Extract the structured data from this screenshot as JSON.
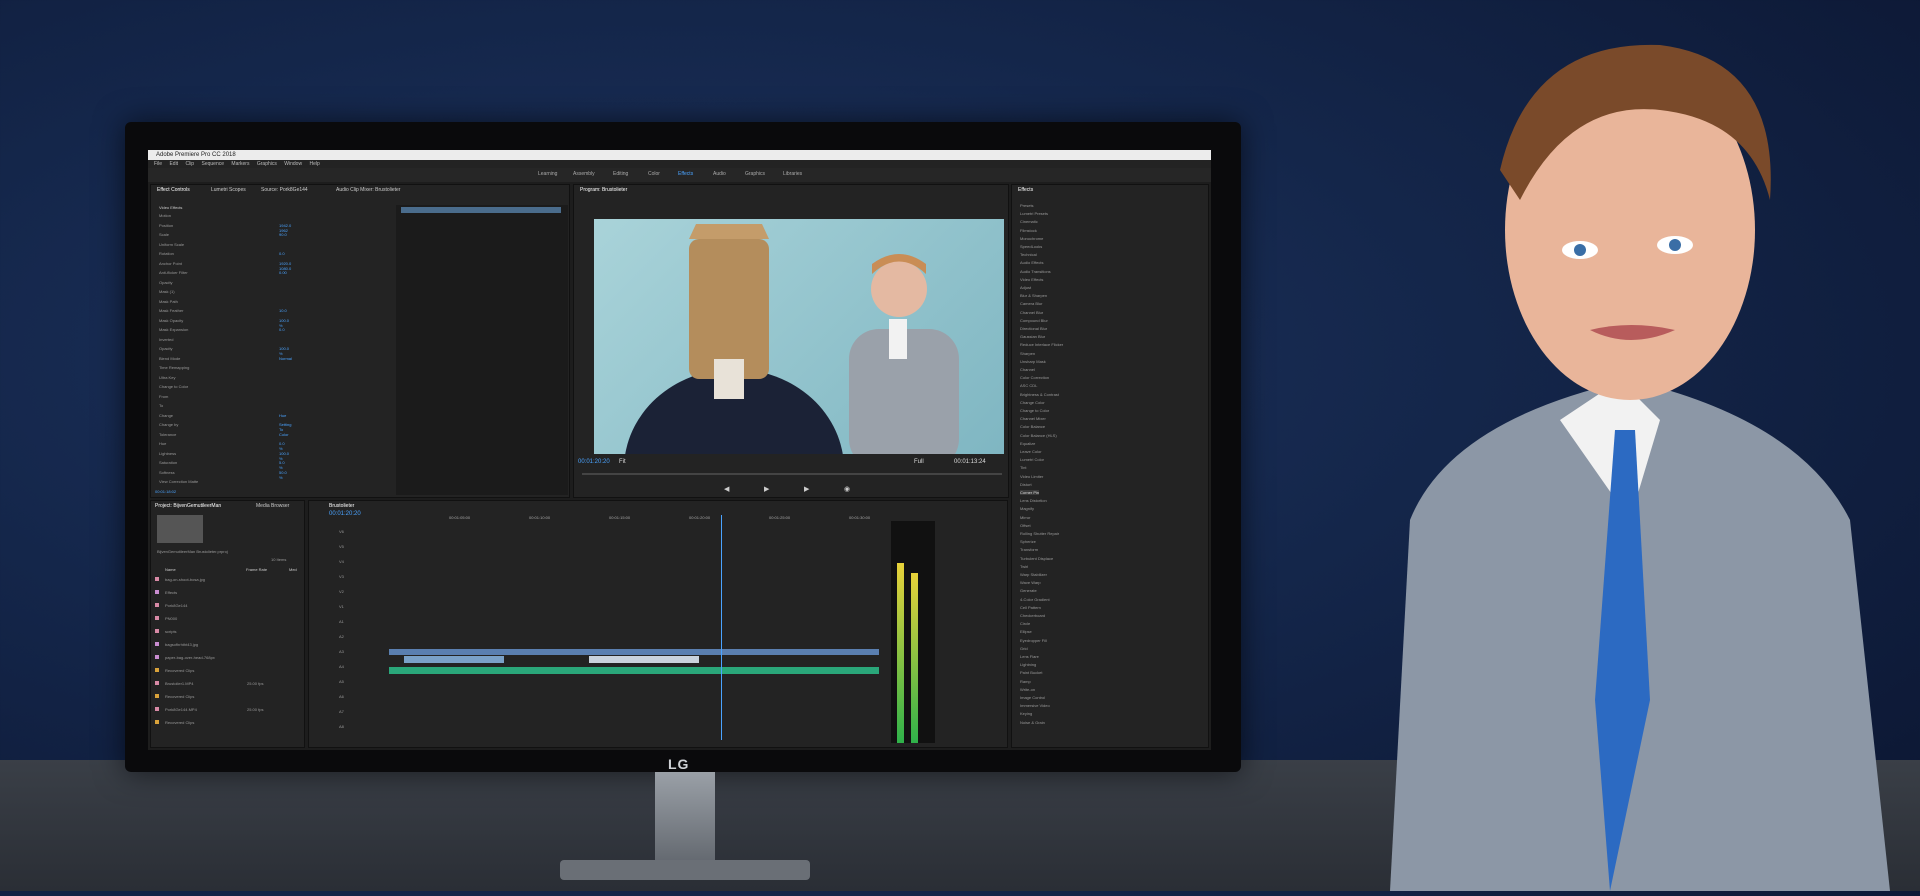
{
  "scene": {
    "monitor_brand": "LG"
  },
  "app": {
    "title": "Adobe Premiere Pro CC 2018",
    "menu": [
      "File",
      "Edit",
      "Clip",
      "Sequence",
      "Markers",
      "Graphics",
      "Window",
      "Help"
    ],
    "workspaces": [
      "Learning",
      "Assembly",
      "Editing",
      "Color",
      "Effects",
      "Audio",
      "Graphics",
      "Libraries"
    ],
    "active_workspace": "Effects"
  },
  "effect_controls": {
    "tabs": [
      "Effect Controls",
      "Lumetri Scopes",
      "Source: Pork8Ge144",
      "Audio Clip Mixer: Brustolieter"
    ],
    "section": "Video Effects",
    "rows": [
      {
        "name": "Motion",
        "value": ""
      },
      {
        "name": "Position",
        "value": "1942.0  1962"
      },
      {
        "name": "Scale",
        "value": "90.0"
      },
      {
        "name": "Uniform Scale",
        "value": ""
      },
      {
        "name": "Rotation",
        "value": "0.0"
      },
      {
        "name": "Anchor Point",
        "value": "1920.0  1080.0"
      },
      {
        "name": "Anti-flicker Filter",
        "value": "0.00"
      },
      {
        "name": "Opacity",
        "value": ""
      },
      {
        "name": "Mask (1)",
        "value": ""
      },
      {
        "name": "Mask Path",
        "value": ""
      },
      {
        "name": "Mask Feather",
        "value": "10.0"
      },
      {
        "name": "Mask Opacity",
        "value": "100.0 %"
      },
      {
        "name": "Mask Expansion",
        "value": "0.0"
      },
      {
        "name": "Inverted",
        "value": ""
      },
      {
        "name": "Opacity",
        "value": "100.0 %"
      },
      {
        "name": "Blend Mode",
        "value": "Normal"
      },
      {
        "name": "Time Remapping",
        "value": ""
      },
      {
        "name": "Ultra Key",
        "value": ""
      },
      {
        "name": "Change to Color",
        "value": ""
      },
      {
        "name": "From",
        "value": ""
      },
      {
        "name": "To",
        "value": ""
      },
      {
        "name": "Change",
        "value": "Hue"
      },
      {
        "name": "Change by",
        "value": "Setting To Color"
      },
      {
        "name": "Tolerance",
        "value": ""
      },
      {
        "name": "Hue",
        "value": "0.0 %"
      },
      {
        "name": "Lightness",
        "value": "100.0 %"
      },
      {
        "name": "Saturation",
        "value": "5.0 %"
      },
      {
        "name": "Softness",
        "value": "50.0 %"
      },
      {
        "name": "View Correction Matte",
        "value": ""
      }
    ],
    "timecode": "00:01:18:02"
  },
  "program_monitor": {
    "title": "Program: Brustolieter",
    "timecode": "00:01:20:20",
    "fit": "Fit",
    "quality": "Full",
    "duration": "00:01:13:24"
  },
  "project": {
    "tabs": [
      "Project: BijvenGemutileerMan",
      "Media Browser"
    ],
    "path": "BijvenGemutileerMan Brustolieter.prproj",
    "item_count": "10 Items",
    "columns": [
      "Name",
      "Frame Rate",
      "Med"
    ],
    "items": [
      {
        "name": "bag-on-shoot-bosa.jpg",
        "rate": ""
      },
      {
        "name": "Effects",
        "rate": ""
      },
      {
        "name": "Pork8Ge144",
        "rate": ""
      },
      {
        "name": "PN000",
        "rate": ""
      },
      {
        "name": "scripts",
        "rate": ""
      },
      {
        "name": "bagsofhrhtht43.jpg",
        "rate": ""
      },
      {
        "name": "paper-bag-over-head-768px",
        "rate": ""
      },
      {
        "name": "Recovered Clips",
        "rate": ""
      },
      {
        "name": "Brustolier1.MP4",
        "rate": "25.00 fps"
      },
      {
        "name": "Recovered Clips",
        "rate": ""
      },
      {
        "name": "Pork8Ge144.MP4",
        "rate": "25.00 fps"
      },
      {
        "name": "Recovered Clips",
        "rate": ""
      }
    ]
  },
  "timeline": {
    "tab": "Brustolieter",
    "timecode": "00:01:20:20",
    "ruler": [
      "00:01:05:00",
      "00:01:10:00",
      "00:01:15:00",
      "00:01:20:00",
      "00:01:25:00",
      "00:01:30:00"
    ],
    "tracks": [
      "V6",
      "V5",
      "V4",
      "V3",
      "V2",
      "V1",
      "A1",
      "A2",
      "A3",
      "A4",
      "A5",
      "A6",
      "A7",
      "A8"
    ]
  },
  "effects_panel": {
    "title": "Effects",
    "items": [
      "Presets",
      "Lumetri Presets",
      "Cinematic",
      "Filmstock",
      "Monochrome",
      "SpeedLooks",
      "Technical",
      "Audio Effects",
      "Audio Transitions",
      "Video Effects",
      "Adjust",
      "Blur & Sharpen",
      "Camera Blur",
      "Channel Blur",
      "Compound Blur",
      "Directional Blur",
      "Gaussian Blur",
      "Reduce Interlace Flicker",
      "Sharpen",
      "Unsharp Mask",
      "Channel",
      "Color Correction",
      "ASC CDL",
      "Brightness & Contrast",
      "Change Color",
      "Change to Color",
      "Channel Mixer",
      "Color Balance",
      "Color Balance (HLS)",
      "Equalize",
      "Leave Color",
      "Lumetri Color",
      "Tint",
      "Video Limiter",
      "Distort",
      "Corner Pin",
      "Lens Distortion",
      "Magnify",
      "Mirror",
      "Offset",
      "Rolling Shutter Repair",
      "Spherize",
      "Transform",
      "Turbulent Displace",
      "Twirl",
      "Warp Stabilizer",
      "Wave Warp",
      "Generate",
      "4-Color Gradient",
      "Cell Pattern",
      "Checkerboard",
      "Circle",
      "Ellipse",
      "Eyedropper Fill",
      "Grid",
      "Lens Flare",
      "Lightning",
      "Paint Bucket",
      "Ramp",
      "Write-on",
      "Image Control",
      "Immersive Video",
      "Keying",
      "Noise & Grain"
    ],
    "selected": "Corner Pin"
  }
}
